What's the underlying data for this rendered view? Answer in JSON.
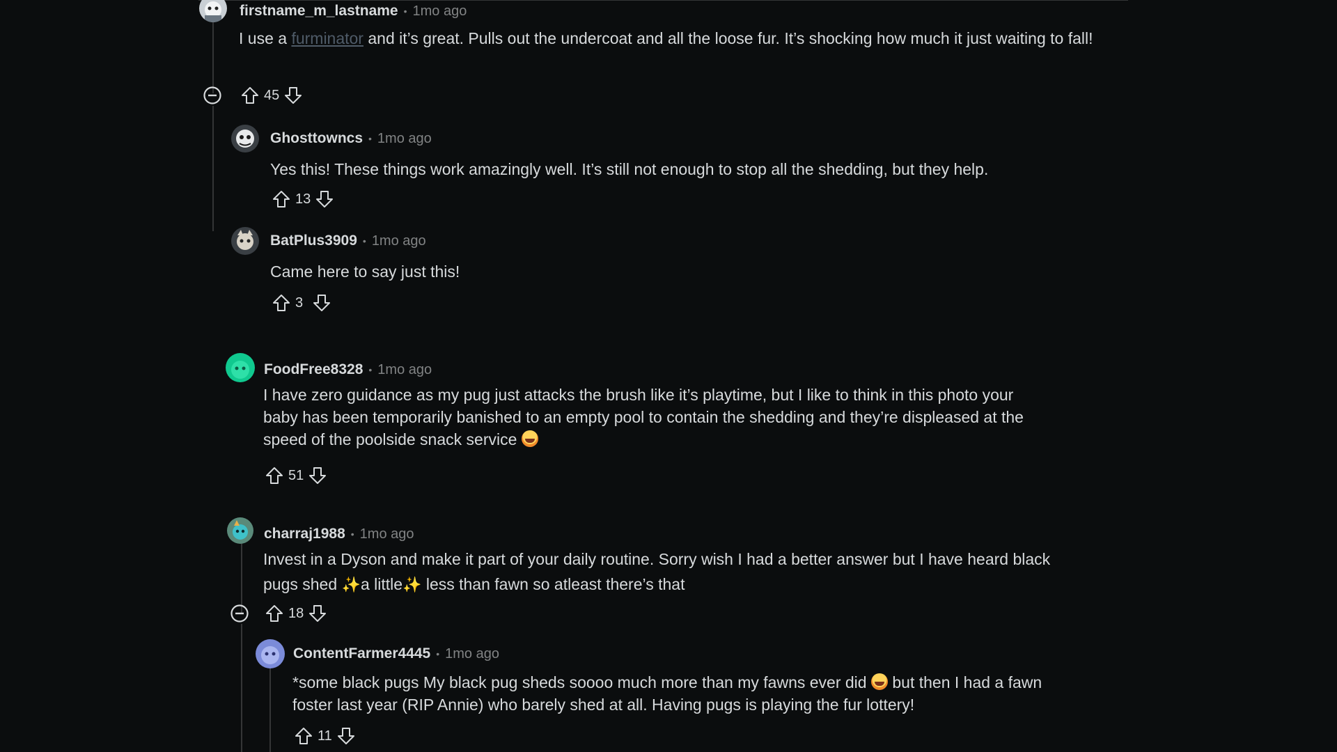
{
  "comments": [
    {
      "author": "firstname_m_lastname",
      "time": "1mo ago",
      "text_before": "I use a ",
      "link": "furminator",
      "text_after": " and it’s great. Pulls out the undercoat and all the loose fur. It’s shocking how much it just waiting to fall!",
      "score": "45"
    },
    {
      "author": "Ghosttowncs",
      "time": "1mo ago",
      "text": "Yes this! These things work amazingly well. It’s still not enough to stop all the shedding, but they help.",
      "score": "13"
    },
    {
      "author": "BatPlus3909",
      "time": "1mo ago",
      "text": "Came here to say just this!",
      "score": "3"
    },
    {
      "author": "FoodFree8328",
      "time": "1mo ago",
      "text_line1": "I have zero guidance as my pug just attacks the brush like it’s playtime, but I like to think in this photo your",
      "text_line2": "baby has been temporarily banished to an empty pool to contain the shedding and they’re displeased at the",
      "text_line3": "speed of the poolside snack service",
      "score": "51"
    },
    {
      "author": "charraj1988",
      "time": "1mo ago",
      "text_line1": "Invest in a Dyson and make it part of your daily routine. Sorry wish I had a better answer but I have heard black",
      "text_line2a": "pugs shed ",
      "text_line2b": "a little",
      "text_line2c": " less than fawn so atleast there’s that",
      "score": "18"
    },
    {
      "author": "ContentFarmer4445",
      "time": "1mo ago",
      "text_line1a": "*some black pugs  My black pug sheds soooo much more than my fawns ever did ",
      "text_line1b": " but then I had a fawn",
      "text_line2": "foster last year (RIP Annie) who barely shed at all. Having pugs is playing the fur lottery!",
      "score": "11"
    }
  ],
  "icons": {
    "upvote": "upvote-arrow-icon",
    "downvote": "downvote-arrow-icon",
    "collapse": "collapse-minus-icon",
    "sparkle": "✨"
  },
  "colors": {
    "background": "#0b0d0e",
    "text": "#d7dadc",
    "muted": "#818384",
    "thread_line": "#343536",
    "link": "#4f5b68"
  }
}
